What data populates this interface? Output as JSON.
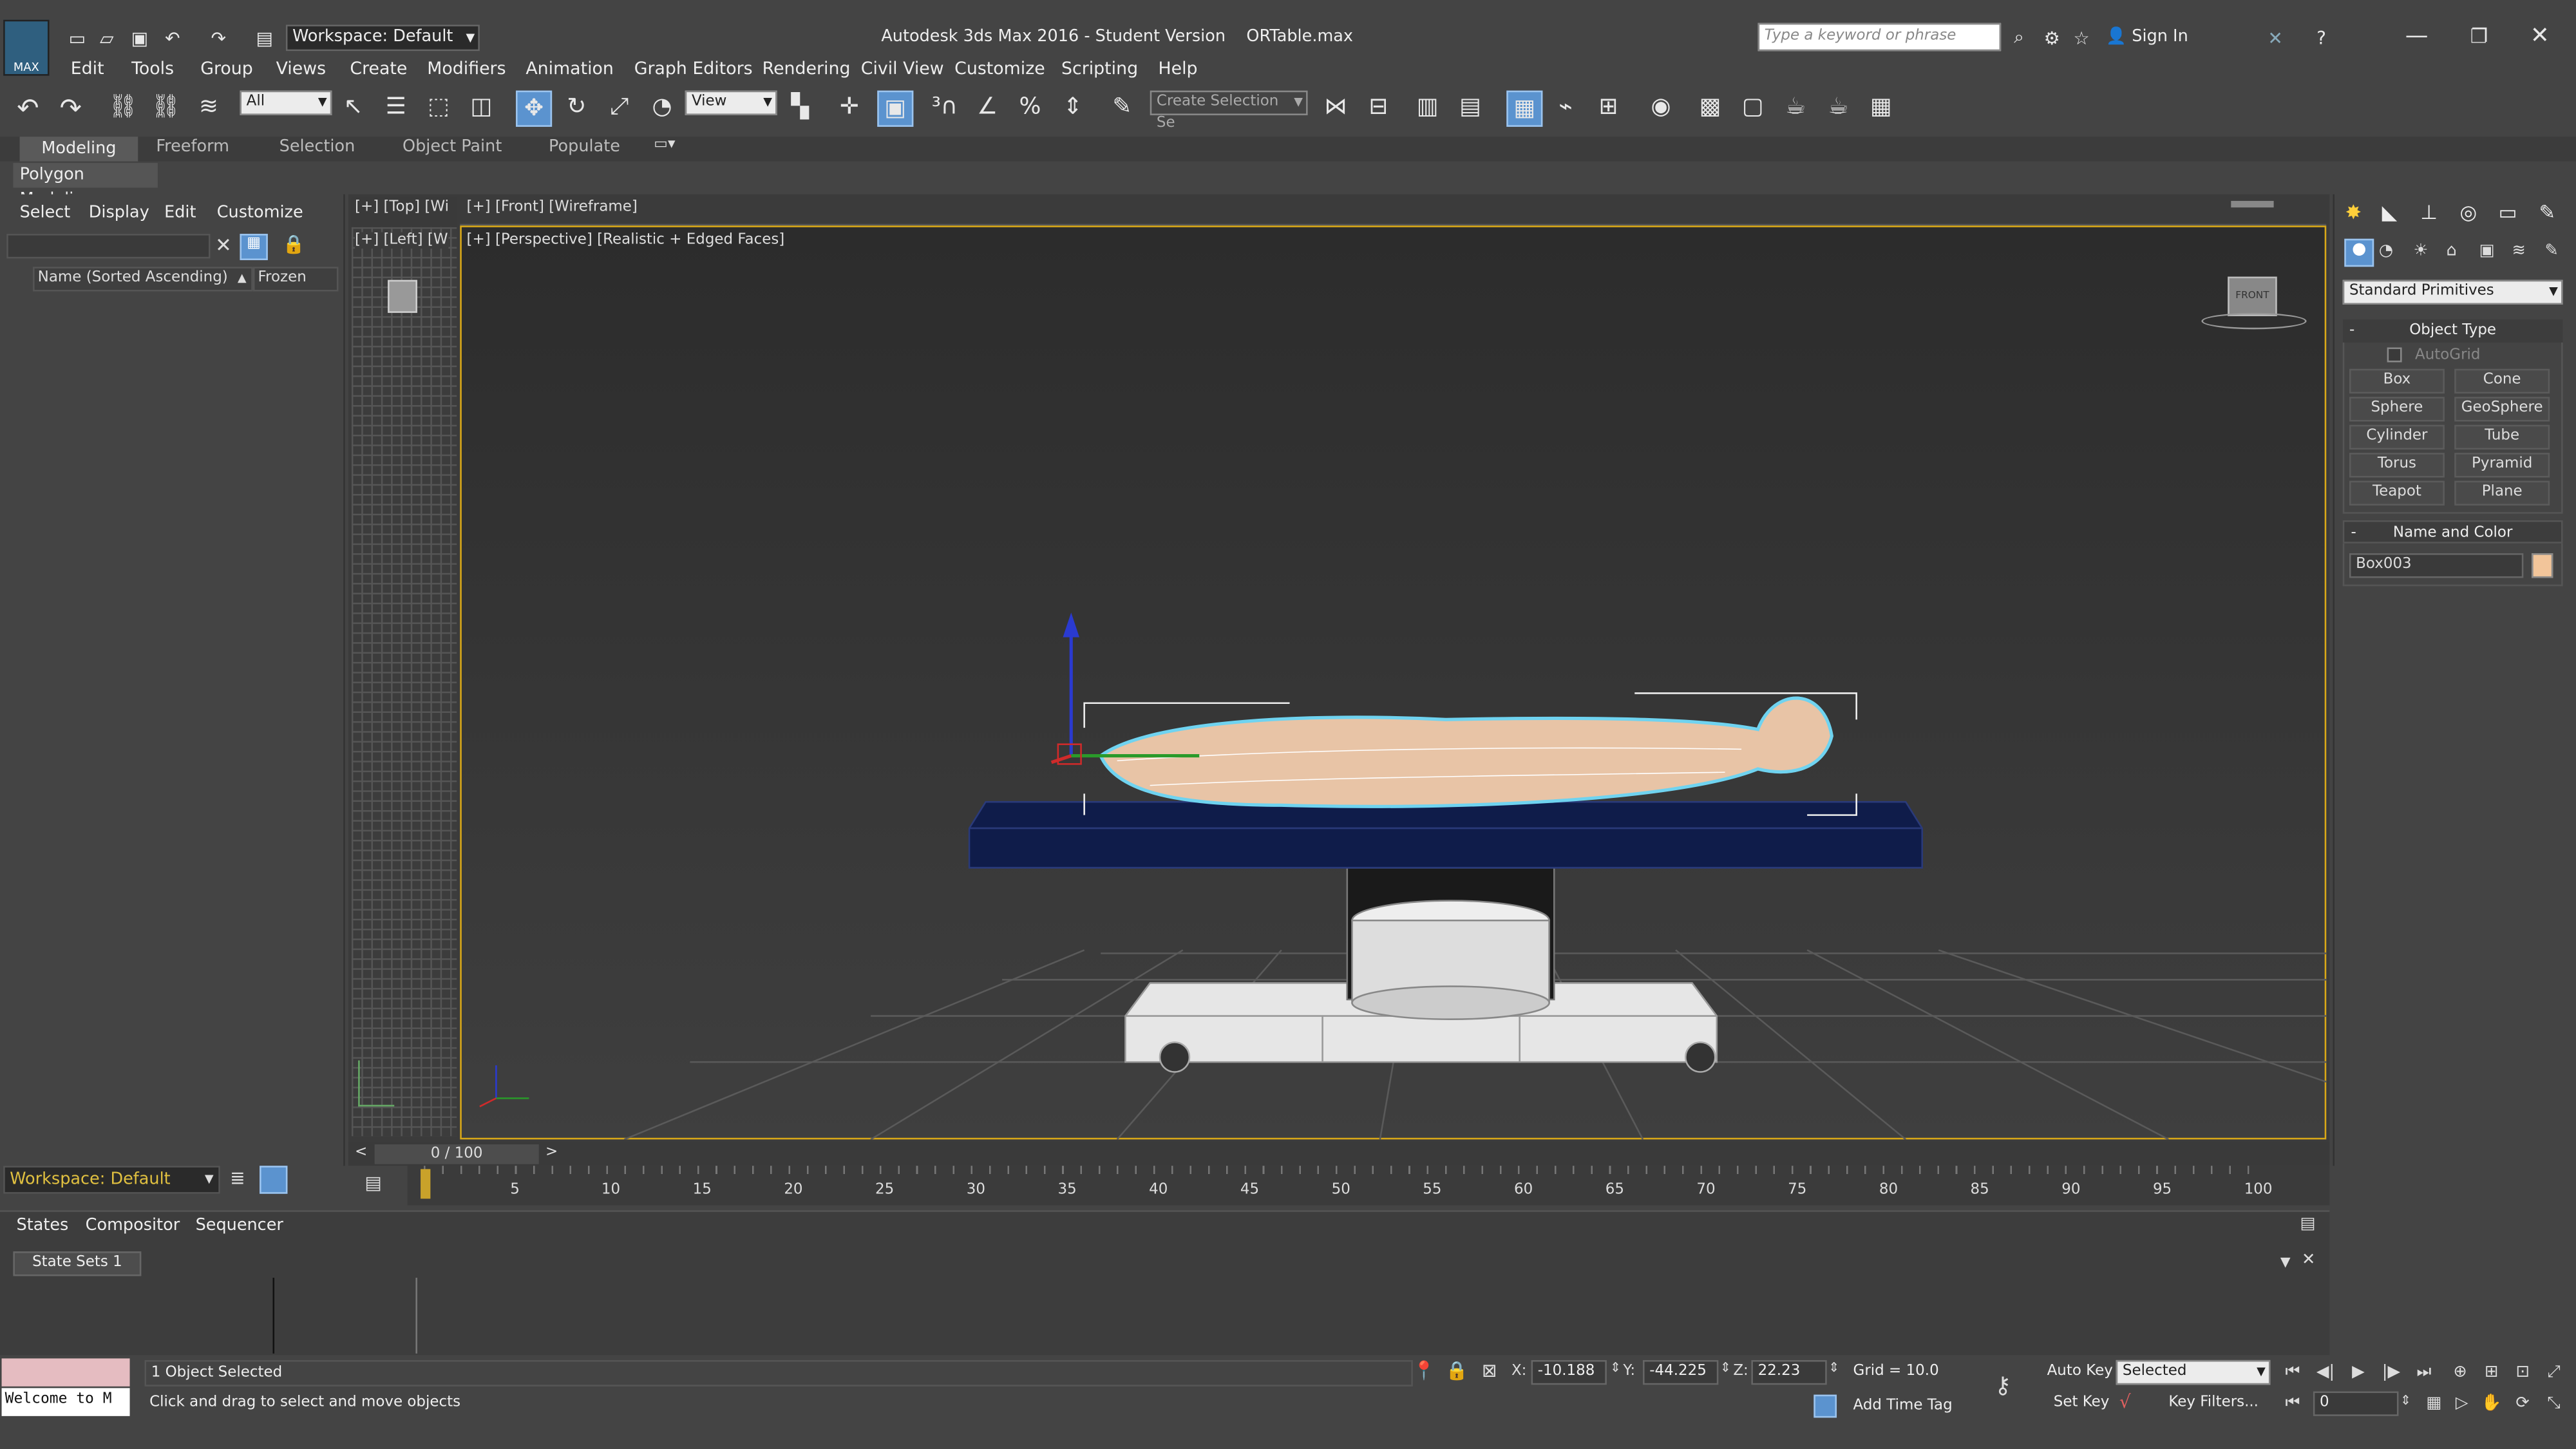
{
  "title_bar": {
    "workspace": "Workspace: Default",
    "title": "Autodesk 3ds Max 2016 - Student Version    ORTable.max",
    "search_placeholder": "Type a keyword or phrase",
    "sign_in": "Sign In",
    "logo": "MAX"
  },
  "menu": [
    "Edit",
    "Tools",
    "Group",
    "Views",
    "Create",
    "Modifiers",
    "Animation",
    "Graph Editors",
    "Rendering",
    "Civil View",
    "Customize",
    "Scripting",
    "Help"
  ],
  "toolbar": {
    "filter_value": "All",
    "ref_coord": "View",
    "selection_set_placeholder": "Create Selection Se"
  },
  "ribbon": {
    "tabs": [
      "Modeling",
      "Freeform",
      "Selection",
      "Object Paint",
      "Populate"
    ],
    "sub": "Polygon Modeling"
  },
  "scene_explorer": {
    "menu": [
      "Select",
      "Display",
      "Edit",
      "Customize"
    ],
    "col_name": "Name (Sorted Ascending)",
    "col_frozen": "Frozen"
  },
  "viewports": {
    "top_label": "[+] [Top] [Wi",
    "front_label": "[+] [Front] [Wireframe]",
    "left_label": "[+] [Left] [W",
    "persp_label": "[+] [Perspective] [Realistic + Edged Faces]",
    "viewcube_label": "FRONT"
  },
  "command_panel": {
    "category": "Standard Primitives",
    "object_type_title": "Object Type",
    "autogrid": "AutoGrid",
    "buttons": [
      "Box",
      "Cone",
      "Sphere",
      "GeoSphere",
      "Cylinder",
      "Tube",
      "Torus",
      "Pyramid",
      "Teapot",
      "Plane"
    ],
    "name_color_title": "Name and Color",
    "object_name": "Box003",
    "object_color": "#f2c59a"
  },
  "timeline": {
    "frame_display": "0 / 100",
    "ticks": [
      "5",
      "10",
      "15",
      "20",
      "25",
      "30",
      "35",
      "40",
      "45",
      "50",
      "55",
      "60",
      "65",
      "70",
      "75",
      "80",
      "85",
      "90",
      "95",
      "100"
    ],
    "workspace": "Workspace: Default"
  },
  "slate": {
    "tabs": [
      "States",
      "Compositor",
      "Sequencer"
    ],
    "state_set": "State Sets 1"
  },
  "status": {
    "maxscript": "Welcome to M",
    "selected": "1 Object Selected",
    "prompt": "Click and drag to select and move objects",
    "x_label": "X:",
    "x": "-10.188",
    "y_label": "Y:",
    "y": "-44.225",
    "z_label": "Z:",
    "z": "22.23",
    "grid": "Grid = 10.0",
    "add_time_tag": "Add Time Tag",
    "auto_key": "Auto Key",
    "selected_dd": "Selected",
    "set_key": "Set Key",
    "key_filters": "Key Filters...",
    "frame_field": "0"
  },
  "colors": {
    "accent": "#3a7cc4",
    "selection_border": "#d9a818",
    "table_top": "#0f1c4a",
    "body": "#e8c4a6"
  }
}
